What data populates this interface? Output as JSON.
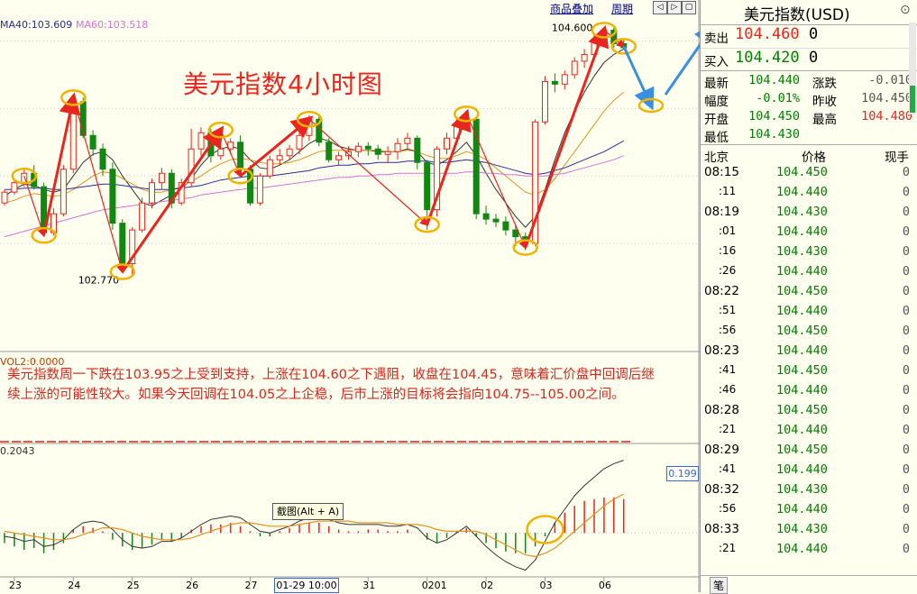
{
  "toolbar": {
    "overlay_label": "商品叠加",
    "period_label": "周期"
  },
  "ma_legend": {
    "ma40": "MA40:103.609",
    "ma60": "MA60:103.518"
  },
  "annotation": {
    "title": "美元指数4小时图",
    "text": "美元指数周一下跌在103.95之上受到支持，上涨在104.60之下遇阻，收盘在104.45，意味着汇价盘中回调后继续上涨的可能性较大。如果今天回调在104.05之上企稳，后市上涨的目标将会指向104.75--105.00之间。"
  },
  "volume_label": "VOL2:0.0000",
  "macd_label": "0.2043",
  "macd_value_box": "0.199",
  "cursor_date": "01-29 10:00",
  "tooltip": "截图(Alt + A)",
  "colors": {
    "up": "#e8251e",
    "down": "#118811",
    "ma_fast": "#333333",
    "ma_mid": "#e8901e",
    "ma_slow": "#2a2a9a",
    "ma_long": "#d870d8",
    "arrow": "#e8251e",
    "forecast": "#3a8fe0",
    "highlight": "#f0b400"
  },
  "chart_data": {
    "type": "candlestick",
    "title": "美元指数4小时图",
    "y_range": [
      102.6,
      104.75
    ],
    "price_labels": {
      "high": "104.600",
      "low": "102.770"
    },
    "x_tick_labels": [
      "23",
      "24",
      "25",
      "26",
      "27",
      "31",
      "0201",
      "02",
      "03",
      "06"
    ],
    "candles": [
      [
        103.3,
        103.38,
        103.28,
        103.4
      ],
      [
        103.38,
        103.45,
        103.36,
        103.48
      ],
      [
        103.45,
        103.52,
        103.42,
        103.56
      ],
      [
        103.52,
        103.42,
        103.4,
        103.58
      ],
      [
        103.42,
        103.08,
        103.05,
        103.45
      ],
      [
        103.08,
        103.22,
        103.06,
        103.26
      ],
      [
        103.22,
        103.55,
        103.2,
        103.58
      ],
      [
        103.55,
        104.05,
        103.52,
        104.1
      ],
      [
        104.05,
        103.8,
        103.78,
        104.08
      ],
      [
        103.8,
        103.7,
        103.65,
        103.84
      ],
      [
        103.7,
        103.55,
        103.5,
        103.74
      ],
      [
        103.55,
        103.15,
        103.1,
        103.6
      ],
      [
        103.15,
        102.85,
        102.8,
        103.18
      ],
      [
        102.85,
        103.1,
        102.77,
        103.12
      ],
      [
        103.1,
        103.3,
        103.08,
        103.34
      ],
      [
        103.3,
        103.45,
        103.26,
        103.48
      ],
      [
        103.45,
        103.52,
        103.4,
        103.56
      ],
      [
        103.52,
        103.3,
        103.26,
        103.55
      ],
      [
        103.3,
        103.45,
        103.28,
        103.48
      ],
      [
        103.45,
        103.7,
        103.42,
        103.85
      ],
      [
        103.7,
        103.82,
        103.65,
        103.86
      ],
      [
        103.82,
        103.65,
        103.6,
        103.85
      ],
      [
        103.65,
        103.7,
        103.62,
        103.72
      ],
      [
        103.7,
        103.75,
        103.66,
        103.78
      ],
      [
        103.75,
        103.55,
        103.5,
        103.8
      ],
      [
        103.55,
        103.3,
        103.28,
        103.58
      ],
      [
        103.3,
        103.5,
        103.28,
        103.52
      ],
      [
        103.5,
        103.62,
        103.48,
        103.65
      ],
      [
        103.62,
        103.65,
        103.58,
        103.7
      ],
      [
        103.65,
        103.7,
        103.62,
        103.73
      ],
      [
        103.7,
        103.8,
        103.66,
        103.88
      ],
      [
        103.8,
        103.92,
        103.76,
        103.95
      ],
      [
        103.92,
        103.75,
        103.72,
        103.95
      ],
      [
        103.75,
        103.62,
        103.6,
        103.78
      ],
      [
        103.62,
        103.65,
        103.58,
        103.68
      ],
      [
        103.65,
        103.68,
        103.62,
        103.72
      ],
      [
        103.68,
        103.72,
        103.64,
        103.75
      ],
      [
        103.72,
        103.7,
        103.65,
        103.75
      ],
      [
        103.7,
        103.66,
        103.62,
        103.73
      ],
      [
        103.66,
        103.68,
        103.6,
        103.72
      ],
      [
        103.68,
        103.74,
        103.62,
        103.78
      ],
      [
        103.74,
        103.78,
        103.7,
        103.82
      ],
      [
        103.78,
        103.6,
        103.55,
        103.8
      ],
      [
        103.6,
        103.25,
        103.1,
        103.62
      ],
      [
        103.25,
        103.7,
        103.2,
        103.72
      ],
      [
        103.7,
        103.78,
        103.66,
        103.82
      ],
      [
        103.78,
        103.88,
        103.74,
        103.92
      ],
      [
        103.88,
        103.92,
        103.84,
        103.98
      ],
      [
        103.92,
        103.22,
        103.18,
        103.94
      ],
      [
        103.22,
        103.18,
        103.14,
        103.28
      ],
      [
        103.18,
        103.16,
        103.12,
        103.22
      ],
      [
        103.16,
        103.1,
        103.06,
        103.2
      ],
      [
        103.1,
        103.05,
        102.98,
        103.14
      ],
      [
        103.05,
        103.0,
        102.95,
        103.08
      ],
      [
        103.0,
        103.9,
        102.98,
        103.92
      ],
      [
        103.9,
        104.2,
        103.88,
        104.24
      ],
      [
        104.2,
        104.18,
        104.12,
        104.26
      ],
      [
        104.18,
        104.25,
        104.14,
        104.28
      ],
      [
        104.25,
        104.35,
        104.22,
        104.38
      ],
      [
        104.35,
        104.4,
        104.3,
        104.44
      ],
      [
        104.4,
        104.5,
        104.36,
        104.56
      ],
      [
        104.5,
        104.58,
        104.46,
        104.6
      ],
      [
        104.58,
        104.48,
        104.45,
        104.6
      ],
      [
        104.48,
        104.45,
        104.44,
        104.52
      ]
    ],
    "ma_lines": [
      {
        "name": "fast",
        "values": [
          103.35,
          103.4,
          103.44,
          103.43,
          103.4,
          103.38,
          103.4,
          103.5,
          103.6,
          103.66,
          103.68,
          103.62,
          103.5,
          103.4,
          103.3,
          103.28,
          103.32,
          103.36,
          103.4,
          103.48,
          103.58,
          103.66,
          103.7,
          103.72,
          103.7,
          103.62,
          103.56,
          103.55,
          103.58,
          103.62,
          103.68,
          103.74,
          103.78,
          103.76,
          103.72,
          103.7,
          103.69,
          103.69,
          103.68,
          103.68,
          103.68,
          103.7,
          103.68,
          103.6,
          103.58,
          103.62,
          103.68,
          103.75,
          103.65,
          103.52,
          103.4,
          103.3,
          103.2,
          103.12,
          103.2,
          103.4,
          103.62,
          103.82,
          103.98,
          104.12,
          104.24,
          104.34,
          104.4,
          104.44
        ]
      },
      {
        "name": "mid",
        "values": [
          103.3,
          103.32,
          103.35,
          103.37,
          103.36,
          103.35,
          103.36,
          103.4,
          103.45,
          103.5,
          103.53,
          103.52,
          103.48,
          103.44,
          103.4,
          103.38,
          103.38,
          103.4,
          103.42,
          103.46,
          103.5,
          103.55,
          103.59,
          103.62,
          103.63,
          103.62,
          103.6,
          103.59,
          103.59,
          103.6,
          103.62,
          103.65,
          103.68,
          103.69,
          103.69,
          103.69,
          103.69,
          103.69,
          103.69,
          103.68,
          103.68,
          103.69,
          103.68,
          103.65,
          103.63,
          103.63,
          103.65,
          103.68,
          103.66,
          103.62,
          103.56,
          103.5,
          103.44,
          103.38,
          103.36,
          103.4,
          103.48,
          103.58,
          103.68,
          103.78,
          103.88,
          103.98,
          104.06,
          104.12
        ]
      },
      {
        "name": "MA40",
        "values": [
          103.4,
          103.4,
          103.41,
          103.41,
          103.41,
          103.4,
          103.4,
          103.41,
          103.42,
          103.43,
          103.44,
          103.44,
          103.43,
          103.42,
          103.41,
          103.4,
          103.4,
          103.4,
          103.41,
          103.42,
          103.43,
          103.45,
          103.47,
          103.48,
          103.49,
          103.5,
          103.5,
          103.5,
          103.51,
          103.52,
          103.53,
          103.54,
          103.56,
          103.57,
          103.58,
          103.58,
          103.59,
          103.59,
          103.6,
          103.6,
          103.6,
          103.61,
          103.61,
          103.61,
          103.6,
          103.6,
          103.61,
          103.62,
          103.61,
          103.6,
          103.58,
          103.56,
          103.54,
          103.52,
          103.51,
          103.52,
          103.54,
          103.56,
          103.59,
          103.62,
          103.65,
          103.68,
          103.72,
          103.76
        ]
      },
      {
        "name": "MA60",
        "values": [
          103.05,
          103.07,
          103.09,
          103.11,
          103.13,
          103.15,
          103.17,
          103.19,
          103.21,
          103.23,
          103.25,
          103.26,
          103.27,
          103.28,
          103.29,
          103.3,
          103.31,
          103.32,
          103.33,
          103.34,
          103.36,
          103.37,
          103.38,
          103.39,
          103.4,
          103.41,
          103.41,
          103.42,
          103.43,
          103.44,
          103.45,
          103.46,
          103.47,
          103.48,
          103.49,
          103.49,
          103.5,
          103.5,
          103.51,
          103.51,
          103.52,
          103.52,
          103.52,
          103.52,
          103.52,
          103.52,
          103.52,
          103.53,
          103.53,
          103.52,
          103.52,
          103.51,
          103.51,
          103.5,
          103.5,
          103.5,
          103.51,
          103.52,
          103.54,
          103.56,
          103.58,
          103.6,
          103.62,
          103.65
        ]
      }
    ],
    "macd_hist": [
      -0.06,
      -0.08,
      -0.1,
      -0.09,
      -0.12,
      -0.1,
      -0.06,
      0.02,
      0.04,
      0.03,
      0.01,
      -0.04,
      -0.08,
      -0.1,
      -0.09,
      -0.07,
      -0.04,
      -0.05,
      -0.03,
      0.02,
      0.04,
      0.05,
      0.05,
      0.06,
      0.04,
      0.01,
      -0.02,
      -0.02,
      0.01,
      0.03,
      0.05,
      0.06,
      0.06,
      0.04,
      0.02,
      0.01,
      0.01,
      0.02,
      0.02,
      0.01,
      0.01,
      0.02,
      0.0,
      -0.04,
      -0.06,
      -0.03,
      0.01,
      0.03,
      -0.02,
      -0.06,
      -0.09,
      -0.11,
      -0.12,
      -0.12,
      -0.08,
      -0.02,
      0.06,
      0.12,
      0.16,
      0.19,
      0.2,
      0.21,
      0.21,
      0.2
    ],
    "macd_dif": [
      -0.02,
      -0.03,
      -0.05,
      -0.04,
      -0.08,
      -0.07,
      -0.04,
      0.02,
      0.06,
      0.07,
      0.06,
      0.02,
      -0.04,
      -0.08,
      -0.09,
      -0.08,
      -0.05,
      -0.05,
      -0.03,
      0.01,
      0.05,
      0.08,
      0.09,
      0.1,
      0.09,
      0.05,
      0.01,
      0.0,
      0.02,
      0.04,
      0.07,
      0.09,
      0.1,
      0.08,
      0.06,
      0.05,
      0.05,
      0.05,
      0.05,
      0.04,
      0.04,
      0.05,
      0.03,
      -0.03,
      -0.06,
      -0.04,
      0.0,
      0.04,
      -0.02,
      -0.08,
      -0.13,
      -0.17,
      -0.2,
      -0.22,
      -0.16,
      -0.05,
      0.06,
      0.14,
      0.22,
      0.28,
      0.33,
      0.38,
      0.41,
      0.43
    ],
    "macd_dea": [
      0.01,
      0.0,
      -0.01,
      -0.02,
      -0.03,
      -0.04,
      -0.04,
      -0.03,
      -0.01,
      0.01,
      0.03,
      0.03,
      0.02,
      0.0,
      -0.02,
      -0.03,
      -0.04,
      -0.04,
      -0.04,
      -0.03,
      -0.01,
      0.01,
      0.03,
      0.05,
      0.06,
      0.06,
      0.05,
      0.04,
      0.04,
      0.04,
      0.05,
      0.06,
      0.07,
      0.07,
      0.07,
      0.07,
      0.06,
      0.06,
      0.06,
      0.06,
      0.05,
      0.05,
      0.05,
      0.04,
      0.02,
      0.01,
      0.01,
      0.01,
      0.01,
      -0.01,
      -0.04,
      -0.07,
      -0.1,
      -0.13,
      -0.14,
      -0.12,
      -0.09,
      -0.04,
      0.01,
      0.06,
      0.11,
      0.16,
      0.2,
      0.23
    ],
    "macd_range": [
      -0.26,
      0.46
    ]
  },
  "panel": {
    "title": "美元指数(USD)",
    "sell": {
      "label": "卖出",
      "price": "104.460",
      "vol": "0"
    },
    "buy": {
      "label": "买入",
      "price": "104.420",
      "vol": "0"
    },
    "stats": [
      {
        "label": "最新",
        "value": "104.440",
        "label2": "涨跌",
        "value2": "-0.010"
      },
      {
        "label": "幅度",
        "value": "-0.01%",
        "label2": "昨收",
        "value2": "104.450"
      },
      {
        "label": "开盘",
        "value": "104.450",
        "label2": "最高",
        "value2": "104.480"
      },
      {
        "label": "最低",
        "value": "104.430",
        "label2": "",
        "value2": ""
      }
    ],
    "tick_header": {
      "time": "北京",
      "price": "价格",
      "vol": "现手"
    },
    "ticks": [
      {
        "time": "08:15",
        "price": "104.450",
        "vol": "0"
      },
      {
        "time": ":11",
        "price": "104.440",
        "vol": "0"
      },
      {
        "time": "08:19",
        "price": "104.430",
        "vol": "0"
      },
      {
        "time": ":01",
        "price": "104.440",
        "vol": "0"
      },
      {
        "time": ":16",
        "price": "104.430",
        "vol": "0"
      },
      {
        "time": ":26",
        "price": "104.440",
        "vol": "0"
      },
      {
        "time": "08:22",
        "price": "104.450",
        "vol": "0"
      },
      {
        "time": ":51",
        "price": "104.440",
        "vol": "0"
      },
      {
        "time": ":56",
        "price": "104.450",
        "vol": "0"
      },
      {
        "time": "08:23",
        "price": "104.440",
        "vol": "0"
      },
      {
        "time": ":41",
        "price": "104.450",
        "vol": "0"
      },
      {
        "time": ":46",
        "price": "104.440",
        "vol": "0"
      },
      {
        "time": "08:28",
        "price": "104.450",
        "vol": "0"
      },
      {
        "time": ":21",
        "price": "104.440",
        "vol": "0"
      },
      {
        "time": "08:29",
        "price": "104.450",
        "vol": "0"
      },
      {
        "time": ":41",
        "price": "104.440",
        "vol": "0"
      },
      {
        "time": "08:32",
        "price": "104.430",
        "vol": "0"
      },
      {
        "time": ":56",
        "price": "104.440",
        "vol": "0"
      },
      {
        "time": "08:33",
        "price": "104.430",
        "vol": "0"
      },
      {
        "time": ":21",
        "price": "104.440",
        "vol": "0"
      }
    ],
    "bottom_tab": "笔"
  }
}
